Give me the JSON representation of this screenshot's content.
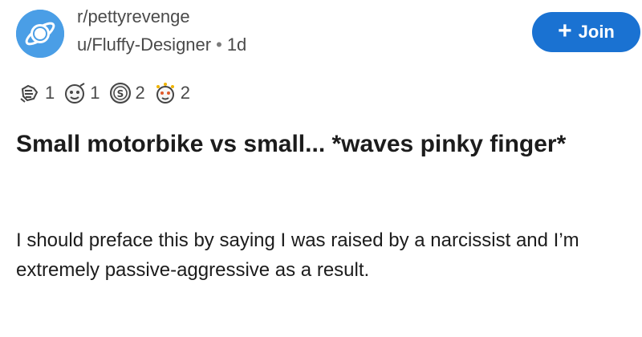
{
  "post": {
    "subreddit": "r/pettyrevenge",
    "author": "u/Fluffy-Designer",
    "separator": "•",
    "age": "1d",
    "join_label": "Join",
    "join_icon": "plus-icon",
    "awards": [
      {
        "icon": "award-icon-1",
        "count": "1"
      },
      {
        "icon": "award-icon-2",
        "count": "1"
      },
      {
        "icon": "award-icon-3",
        "count": "2"
      },
      {
        "icon": "award-icon-4",
        "count": "2"
      }
    ],
    "title": "Small motorbike vs small... *waves pinky finger*",
    "body": "I should preface this by saying I was raised by a narcissist and I’m extremely passive-aggressive as a result."
  },
  "colors": {
    "join_button": "#1a72d2",
    "avatar": "#4a9ee6",
    "meta_text": "#4a4a4a"
  }
}
